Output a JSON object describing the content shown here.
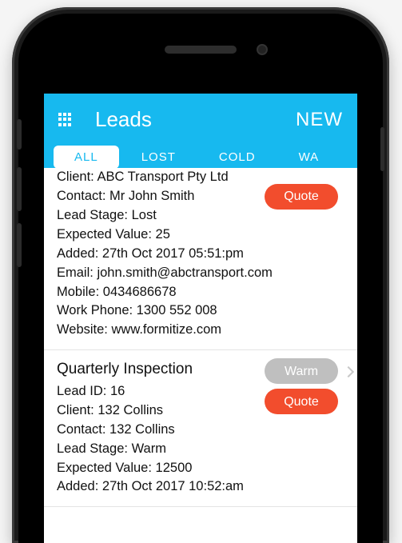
{
  "header": {
    "title": "Leads",
    "action": "NEW"
  },
  "tabs": {
    "items": [
      {
        "label": "ALL",
        "active": true
      },
      {
        "label": "LOST",
        "active": false
      },
      {
        "label": "COLD",
        "active": false
      },
      {
        "label": "WA",
        "active": false
      }
    ]
  },
  "leads": [
    {
      "client_label": "Client:",
      "client": "ABC Transport Pty Ltd",
      "contact_label": "Contact:",
      "contact": "Mr John Smith",
      "stage_label": "Lead Stage:",
      "stage": "Lost",
      "expected_label": "Expected Value:",
      "expected": "25",
      "added_label": "Added:",
      "added": "27th Oct 2017 05:51:pm",
      "email_label": "Email:",
      "email": "john.smith@abctransport.com",
      "mobile_label": "Mobile:",
      "mobile": "0434686678",
      "work_label": "Work Phone:",
      "work": "1300 552 008",
      "website_label": "Website:",
      "website": "www.formitize.com",
      "pill_quote": "Quote"
    },
    {
      "title": "Quarterly Inspection",
      "leadid_label": "Lead ID:",
      "leadid": "16",
      "client_label": "Client:",
      "client": "132 Collins",
      "contact_label": "Contact:",
      "contact": "132 Collins",
      "stage_label": "Lead Stage:",
      "stage": "Warm",
      "expected_label": "Expected Value:",
      "expected": "12500",
      "added_label": "Added:",
      "added": "27th Oct 2017 10:52:am",
      "pill_warm": "Warm",
      "pill_quote": "Quote"
    }
  ]
}
